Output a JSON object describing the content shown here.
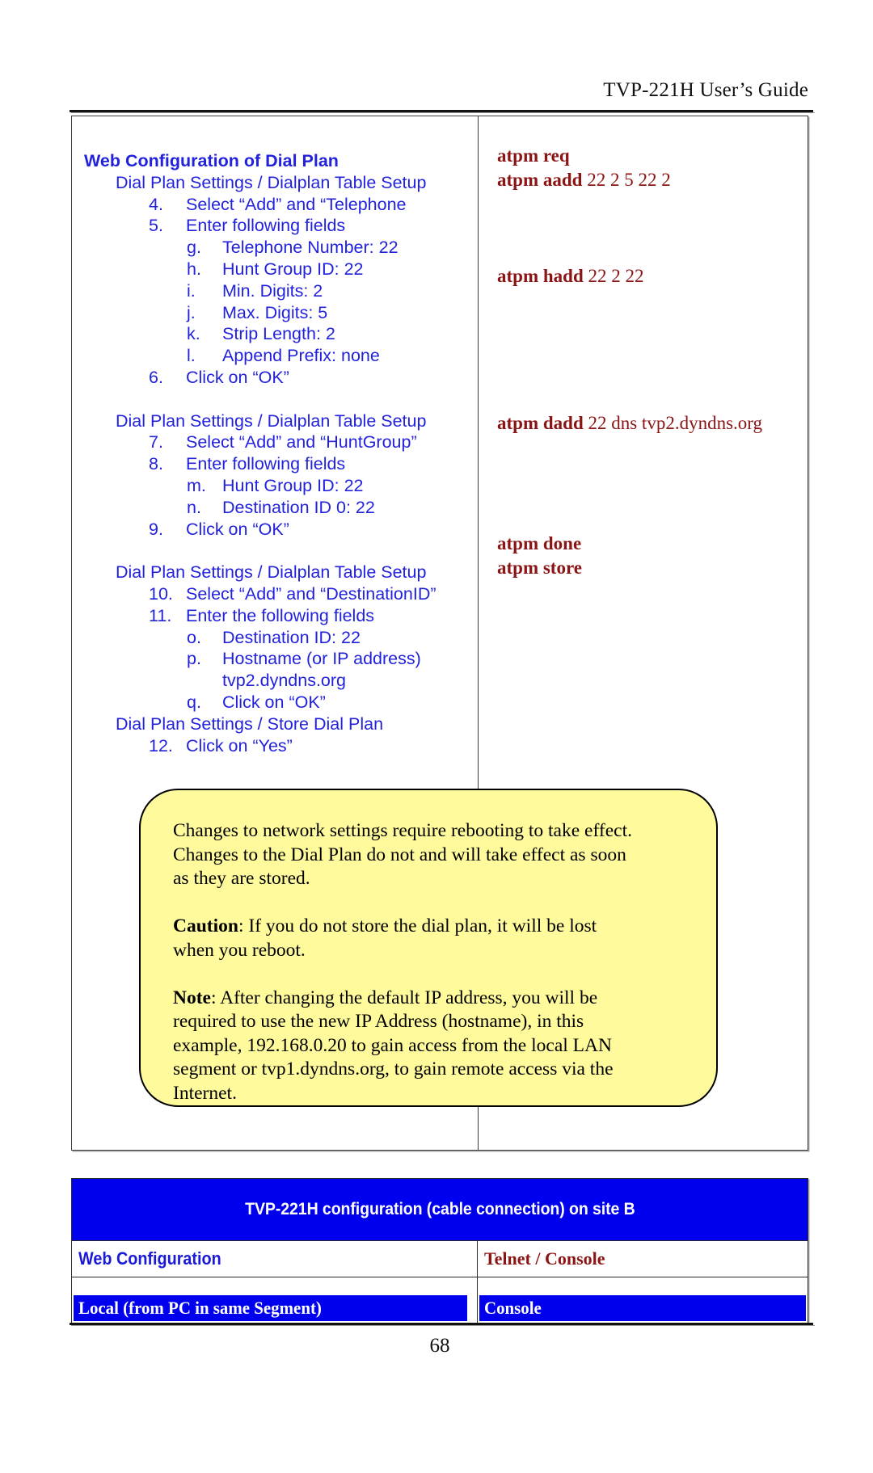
{
  "header": {
    "title": "TVP-221H User’s Guide"
  },
  "left_column": {
    "heading": "Web Configuration of Dial Plan",
    "lines": [
      {
        "marker": "",
        "text": "Dial Plan Settings / Dialplan Table Setup"
      },
      {
        "marker": "4.",
        "text": "Select “Add” and “Telephone"
      },
      {
        "marker": "5.",
        "text": "Enter following fields"
      },
      {
        "marker": "g.",
        "text": "Telephone Number: 22"
      },
      {
        "marker": "h.",
        "text": "Hunt Group ID:  22"
      },
      {
        "marker": "i.",
        "text": "Min. Digits:  2"
      },
      {
        "marker": "j.",
        "text": "Max. Digits:  5"
      },
      {
        "marker": "k.",
        "text": "Strip Length:  2"
      },
      {
        "marker": "l.",
        "text": "Append Prefix: none"
      },
      {
        "marker": "6.",
        "text": "Click on “OK”"
      },
      {
        "marker": "",
        "text": "Dial Plan Settings / Dialplan Table Setup"
      },
      {
        "marker": "7.",
        "text": "Select “Add” and “HuntGroup”"
      },
      {
        "marker": "8.",
        "text": "Enter following fields"
      },
      {
        "marker": "m.",
        "text": "Hunt Group ID: 22"
      },
      {
        "marker": "n.",
        "text": "Destination ID 0: 22"
      },
      {
        "marker": "9.",
        "text": "Click on “OK”"
      },
      {
        "marker": "",
        "text": "Dial Plan Settings / Dialplan Table Setup"
      },
      {
        "marker": "10.",
        "text": "Select “Add” and “DestinationID”"
      },
      {
        "marker": "11.",
        "text": "Enter the following fields"
      },
      {
        "marker": "o.",
        "text": "Destination ID: 22"
      },
      {
        "marker": "p.",
        "text": "Hostname (or IP address)"
      },
      {
        "marker": "",
        "text": "tvp2.dyndns.org"
      },
      {
        "marker": "q.",
        "text": "Click on “OK”"
      },
      {
        "marker": "",
        "text": "Dial Plan Settings / Store Dial Plan"
      },
      {
        "marker": "12.",
        "text": "Click on “Yes”"
      }
    ]
  },
  "right_column": {
    "commands": [
      {
        "cmd": "atpm req",
        "args": ""
      },
      {
        "cmd": "atpm aadd",
        "args": " 22 2 5 22 2"
      },
      {
        "cmd": "atpm hadd",
        "args": " 22 2 22"
      },
      {
        "cmd": "atpm dadd",
        "args": " 22 dns tvp2.dyndns.org"
      },
      {
        "cmd": "atpm done",
        "args": ""
      },
      {
        "cmd": "atpm store",
        "args": ""
      }
    ]
  },
  "callout": {
    "p1": [
      "Changes to network settings require rebooting to take effect.",
      "Changes to the Dial Plan do not and will take effect as soon",
      "as they are stored."
    ],
    "p2_label": "Caution",
    "p2": [
      ": If you do not store the dial plan, it will be lost",
      "when you reboot."
    ],
    "p3_label": "Note",
    "p3": [
      ":  After changing the default IP address, you will be",
      "required to use the new IP Address (hostname), in this",
      "example, 192.168.0.20 to gain access from the local LAN",
      "segment or  tvp1.dyndns.org, to gain remote access via the",
      "Internet."
    ]
  },
  "bottom_table": {
    "title": "TVP-221H configuration (cable connection) on site B",
    "col_left_header": "Web Configuration",
    "col_right_header": "Telnet / Console",
    "col_left_value": "Local (from PC in same Segment)",
    "col_right_value": "Console"
  },
  "footer": {
    "page_number": "68"
  },
  "colors": {
    "blue_text": "#2222dd",
    "blue_band": "#0000ee",
    "dark_red": "#8b1414",
    "callout_yellow": "#fffb9c",
    "rule": "#111111"
  }
}
